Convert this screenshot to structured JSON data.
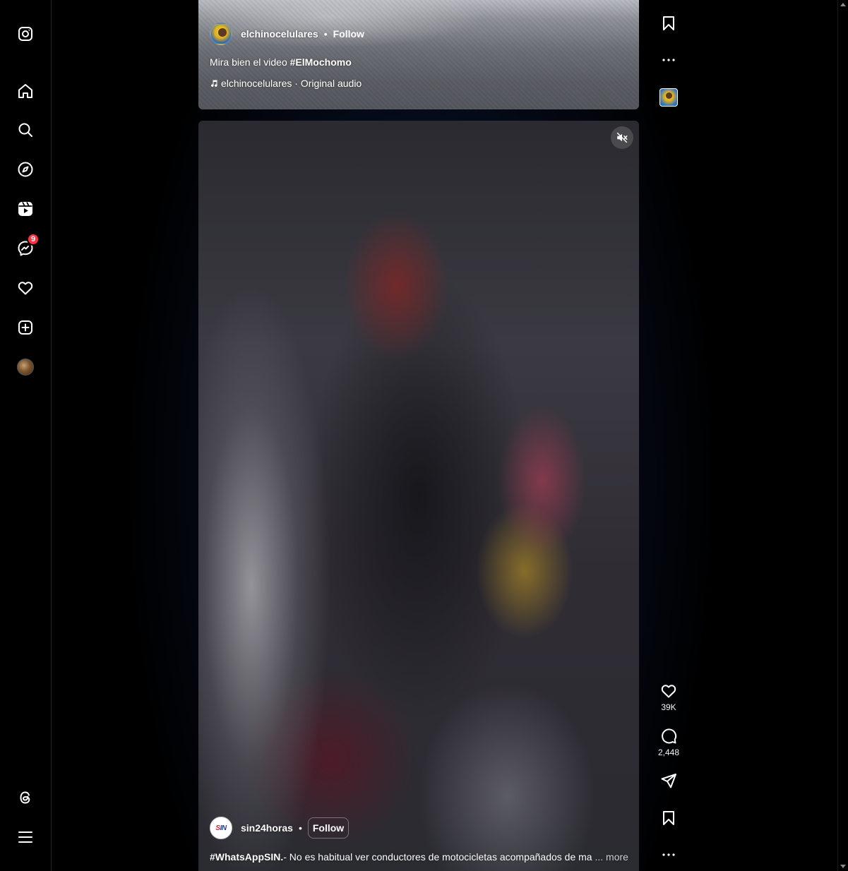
{
  "nav": {
    "items": [
      {
        "name": "instagram-logo-icon"
      },
      {
        "name": "home-icon"
      },
      {
        "name": "search-icon"
      },
      {
        "name": "explore-icon"
      },
      {
        "name": "reels-icon"
      },
      {
        "name": "messenger-icon",
        "badge": "9"
      },
      {
        "name": "notifications-heart-icon"
      },
      {
        "name": "create-icon"
      },
      {
        "name": "profile-avatar"
      },
      {
        "name": "threads-icon"
      },
      {
        "name": "more-menu-icon"
      }
    ]
  },
  "reel_top": {
    "username": "elchinocelulares",
    "dot": "•",
    "follow_label": "Follow",
    "caption_text": "Mira bien el video ",
    "caption_hashtag": "#ElMochomo",
    "audio": "elchinocelulares · Original audio"
  },
  "reel_main": {
    "username": "sin24horas",
    "dot": "•",
    "follow_label": "Follow",
    "caption_hashtag": "#WhatsAppSIN.",
    "caption_text": "- No es habitual ver conductores de motocicletas acompañados de ma",
    "ellipsis": "...",
    "more_label": "more",
    "avatar_text": "SIN"
  },
  "actions": {
    "likes": "39K",
    "comments": "2,448"
  },
  "colors": {
    "badge": "#ff3040",
    "background": "#000000",
    "text": "#f5f5f5"
  }
}
